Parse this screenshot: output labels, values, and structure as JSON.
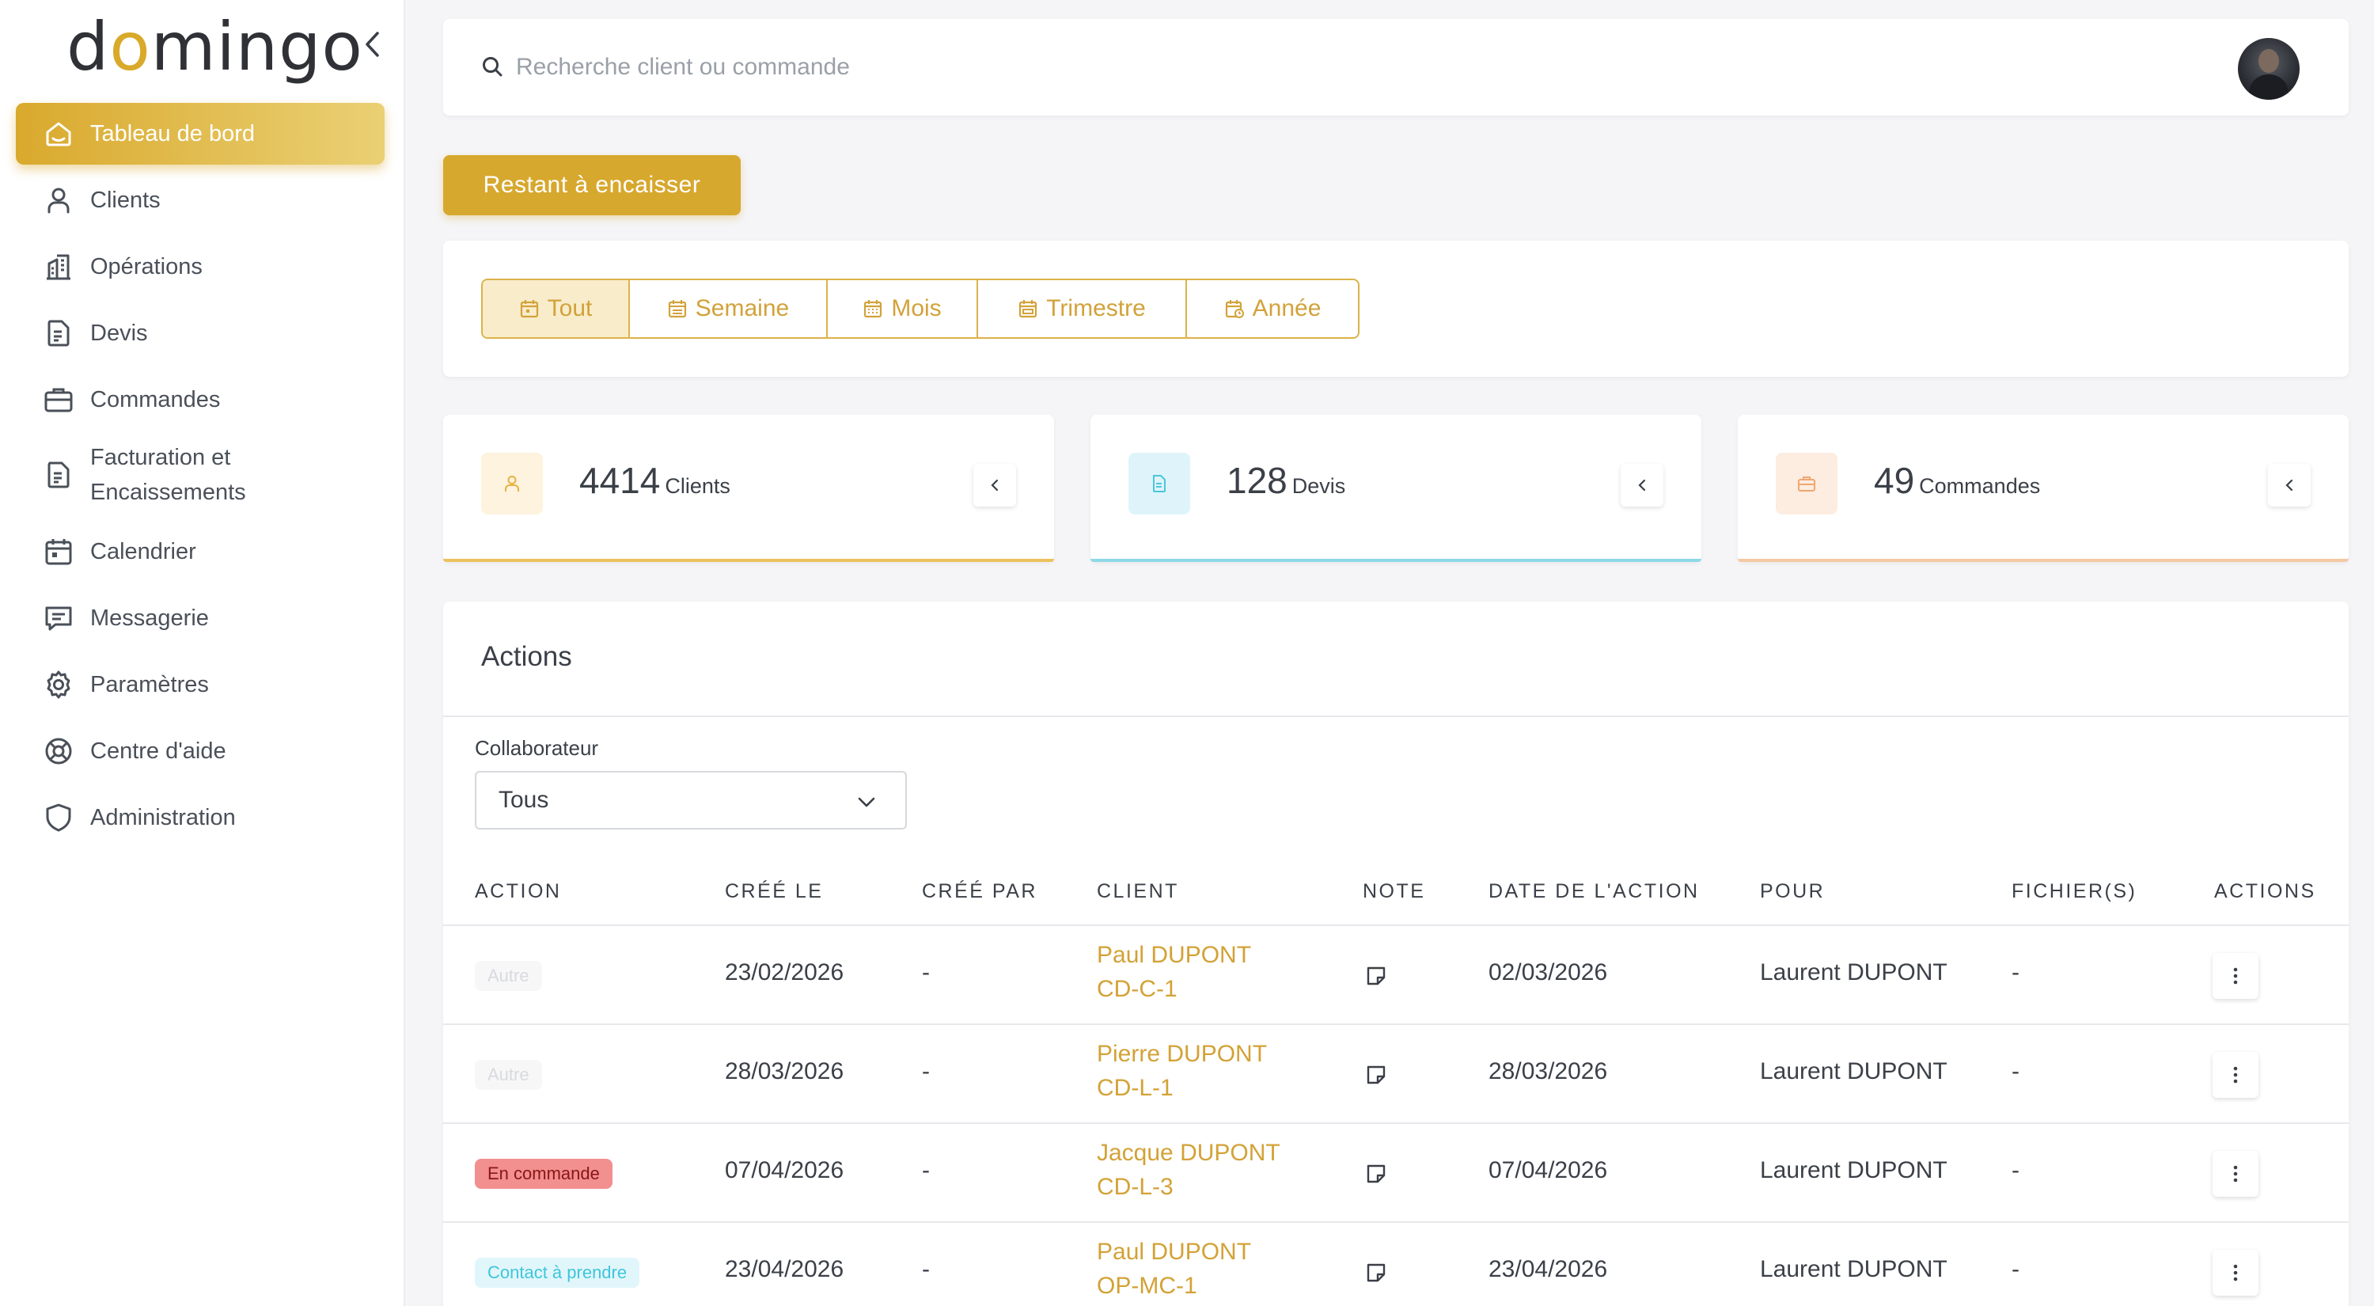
{
  "app": {
    "logo_text_left": "d",
    "logo_sun": "o",
    "logo_text_right": "mingo",
    "brand_color": "#D7A82E"
  },
  "sidebar": {
    "items": [
      {
        "label": "Tableau de bord",
        "icon": "home-icon",
        "active": true
      },
      {
        "label": "Clients",
        "icon": "user-icon"
      },
      {
        "label": "Opérations",
        "icon": "building-icon"
      },
      {
        "label": "Devis",
        "icon": "document-icon"
      },
      {
        "label": "Commandes",
        "icon": "briefcase-icon"
      },
      {
        "label": "Facturation et",
        "label2": "Encaissements",
        "icon": "invoice-icon"
      },
      {
        "label": "Calendrier",
        "icon": "calendar-icon"
      },
      {
        "label": "Messagerie",
        "icon": "message-icon"
      },
      {
        "label": "Paramètres",
        "icon": "gear-icon"
      },
      {
        "label": "Centre d'aide",
        "icon": "lifebuoy-icon"
      },
      {
        "label": "Administration",
        "icon": "shield-icon"
      }
    ]
  },
  "search": {
    "placeholder": "Recherche client ou commande",
    "value": ""
  },
  "restant_button": "Restant à encaisser",
  "periods": [
    {
      "label": "Tout",
      "active": true
    },
    {
      "label": "Semaine"
    },
    {
      "label": "Mois"
    },
    {
      "label": "Trimestre"
    },
    {
      "label": "Année"
    }
  ],
  "stats": [
    {
      "value": "4414",
      "unit": "Clients",
      "icon": "user-icon",
      "color": "#E8B84A"
    },
    {
      "value": "128",
      "unit": "Devis",
      "icon": "document-icon",
      "color": "#4BC6DD"
    },
    {
      "value": "49",
      "unit": "Commandes",
      "icon": "briefcase-icon",
      "color": "#F0A772"
    }
  ],
  "actions": {
    "title": "Actions",
    "collaborateur_label": "Collaborateur",
    "collaborateur_value": "Tous",
    "columns": [
      "ACTION",
      "CRÉÉ LE",
      "CRÉÉ PAR",
      "CLIENT",
      "NOTE",
      "DATE DE L'ACTION",
      "POUR",
      "FICHIER(S)",
      "ACTIONS"
    ],
    "rows": [
      {
        "badge": "Autre",
        "badge_type": "autre",
        "created": "23/02/2026",
        "by": "-",
        "client": "Paul DUPONT",
        "ref": "CD-C-1",
        "date": "02/03/2026",
        "for": "Laurent DUPONT",
        "files": "-"
      },
      {
        "badge": "Autre",
        "badge_type": "autre",
        "created": "28/03/2026",
        "by": "-",
        "client": "Pierre DUPONT",
        "ref": "CD-L-1",
        "date": "28/03/2026",
        "for": "Laurent DUPONT",
        "files": "-"
      },
      {
        "badge": "En commande",
        "badge_type": "commande",
        "created": "07/04/2026",
        "by": "-",
        "client": "Jacque DUPONT",
        "ref": "CD-L-3",
        "date": "07/04/2026",
        "for": "Laurent DUPONT",
        "files": "-"
      },
      {
        "badge": "Contact à prendre",
        "badge_type": "contact",
        "created": "23/04/2026",
        "by": "-",
        "client": "Paul DUPONT",
        "ref": "OP-MC-1",
        "date": "23/04/2026",
        "for": "Laurent DUPONT",
        "files": "-"
      }
    ]
  }
}
